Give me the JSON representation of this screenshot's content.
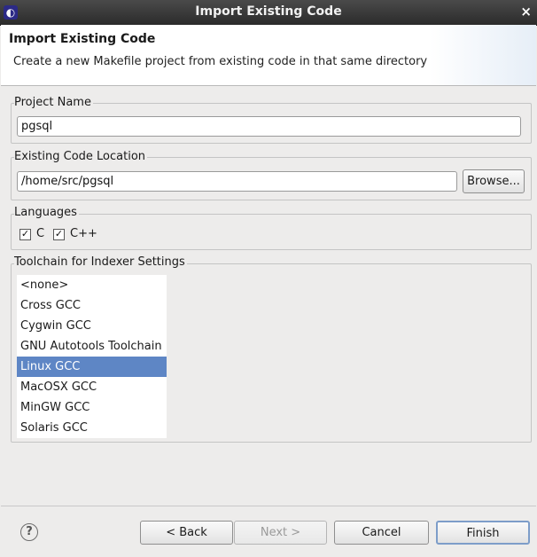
{
  "window": {
    "title": "Import Existing Code",
    "close_glyph": "×",
    "app_icon": "eclipse-icon"
  },
  "banner": {
    "title": "Import Existing Code",
    "description": "Create a new Makefile project from existing code in that same directory"
  },
  "project_name": {
    "label": "Project Name",
    "value": "pgsql"
  },
  "code_location": {
    "label": "Existing Code Location",
    "value": "/home/src/pgsql",
    "browse_label": "Browse..."
  },
  "languages": {
    "label": "Languages",
    "items": [
      {
        "label": "C",
        "checked": true
      },
      {
        "label": "C++",
        "checked": true
      }
    ]
  },
  "toolchain": {
    "label": "Toolchain for Indexer Settings",
    "items": [
      "<none>",
      "Cross GCC",
      "Cygwin GCC",
      "GNU Autotools Toolchain",
      "Linux GCC",
      "MacOSX GCC",
      "MinGW GCC",
      "Solaris GCC"
    ],
    "selected": "Linux GCC"
  },
  "buttons": {
    "help": "?",
    "back": "< Back",
    "next": "Next >",
    "cancel": "Cancel",
    "finish": "Finish"
  },
  "colors": {
    "selection": "#5e86c5",
    "titlebar": "#333333"
  }
}
